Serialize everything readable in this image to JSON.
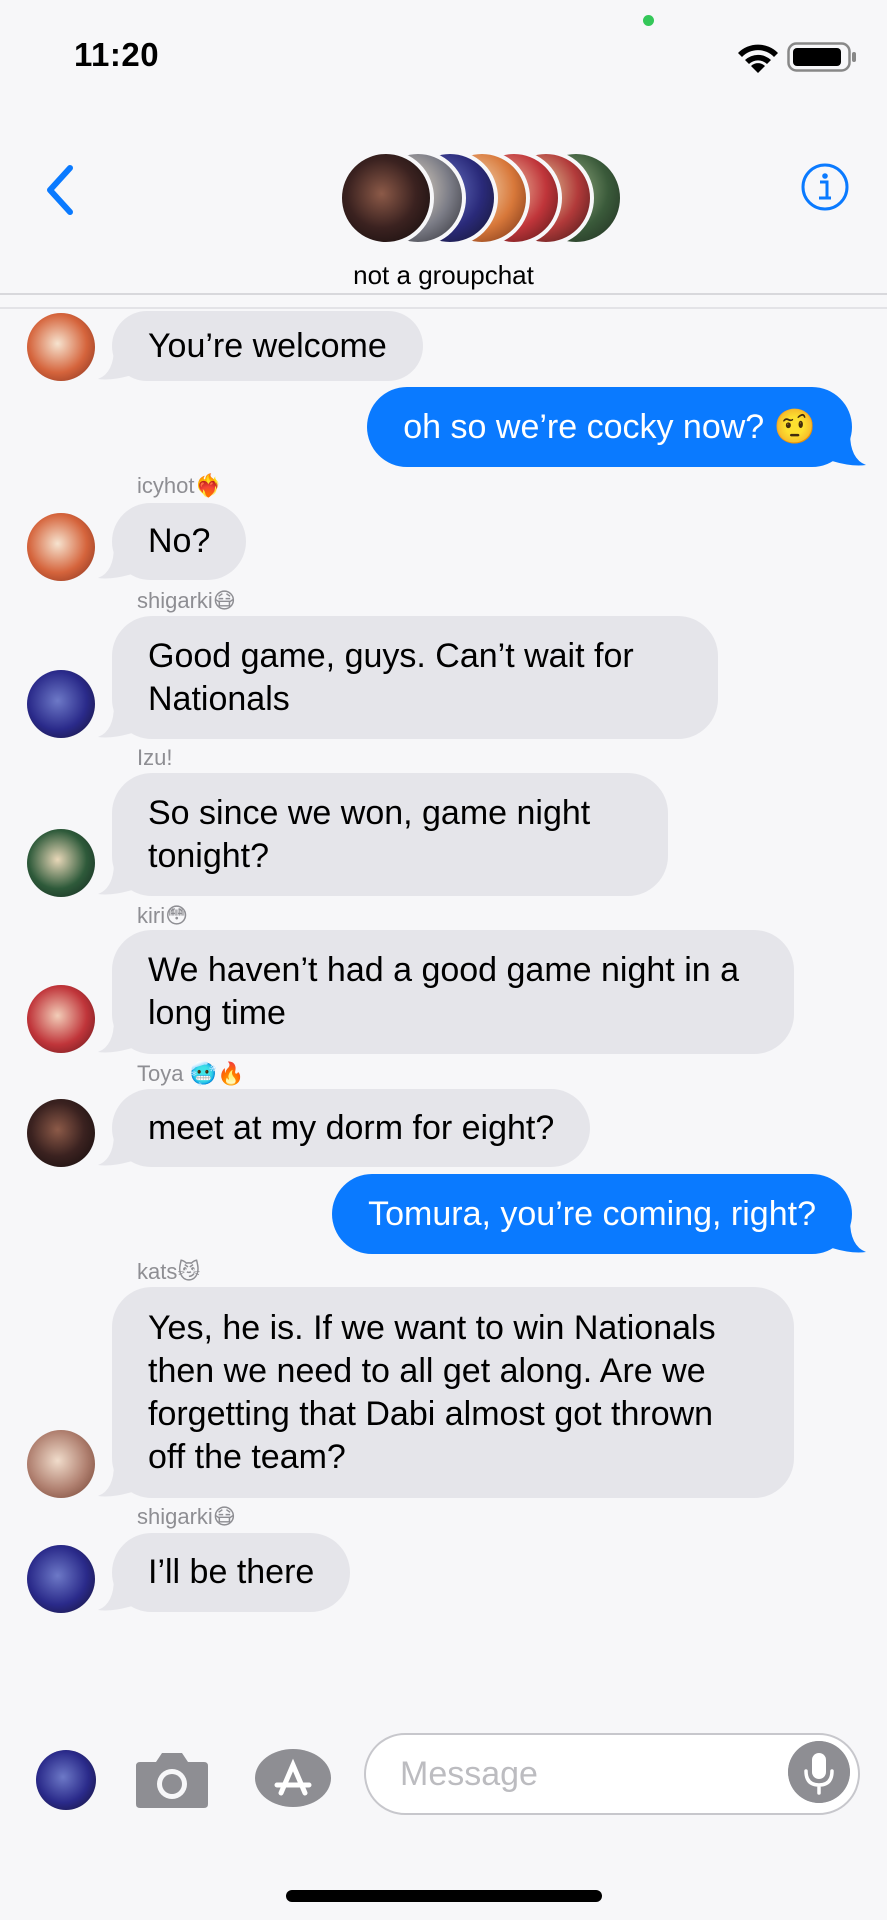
{
  "status_bar": {
    "time": "11:20"
  },
  "header": {
    "title": "not a groupchat"
  },
  "messages": [
    {
      "text": "You’re welcome"
    },
    {
      "text": "oh so we’re cocky now? 🤨"
    },
    {
      "sender": "icyhot❤️‍🔥",
      "text": "No?"
    },
    {
      "sender": "shigarki😷",
      "text": "Good game, guys. Can’t wait for Nationals"
    },
    {
      "sender": "Izu!",
      "text": "So since we won, game night tonight?"
    },
    {
      "sender": "kiri😳",
      "text": "We haven’t had a good game night in a long time"
    },
    {
      "sender": "Toya 🥶🔥",
      "text": "meet at my dorm for eight?"
    },
    {
      "text": "Tomura, you’re coming, right?"
    },
    {
      "sender": "kats😼",
      "text": "Yes, he is. If we want to win Nationals then we need to all get along. Are we forgetting that Dabi almost got thrown off the team?"
    },
    {
      "sender": "shigarki😷",
      "text": "I’ll be there"
    }
  ],
  "composer": {
    "placeholder": "Message"
  },
  "colors": {
    "outgoing_bubble": "#0a7aff",
    "incoming_bubble": "#e5e5ea",
    "accent": "#0a7aff"
  }
}
